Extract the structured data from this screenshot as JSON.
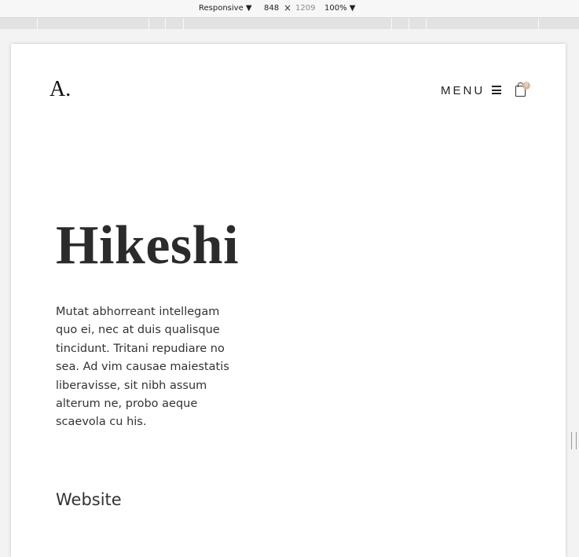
{
  "devtools": {
    "device_mode": "Responsive",
    "width": "848",
    "height": "1209",
    "zoom": "100%",
    "times": "×",
    "arrow": "▼"
  },
  "site": {
    "logo": "A.",
    "menu_label": "MENU",
    "cart_count": "0",
    "title": "Hikeshi",
    "description": "Mutat abhorreant intellegam quo ei, nec at duis qualisque tincidunt. Tritani repudiare no sea. Ad vim causae maiestatis liberavisse, sit nibh assum alterum ne, probo aeque scaevola cu his.",
    "website_heading": "Website"
  },
  "colors": {
    "badge": "#d9b79c",
    "title": "#2b2b2b",
    "text": "#333333"
  },
  "icons": [
    "hamburger-icon",
    "shopping-bag-icon",
    "resize-handle-icon"
  ]
}
